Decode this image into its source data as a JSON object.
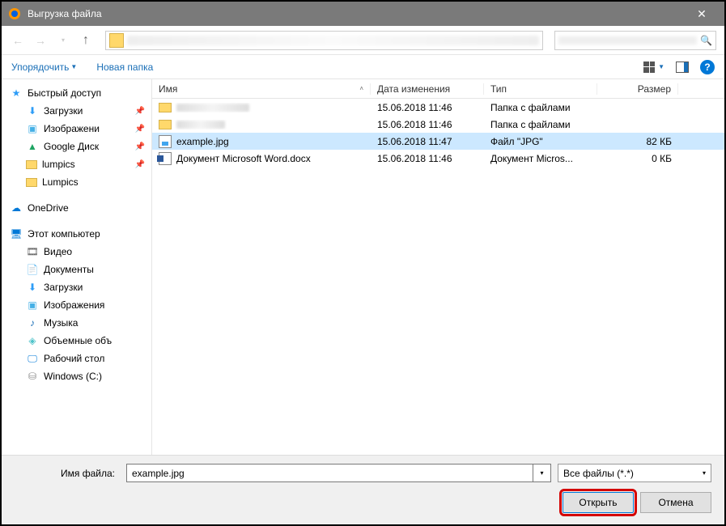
{
  "title": "Выгрузка файла",
  "toolbar": {
    "organize": "Упорядочить",
    "newfolder": "Новая папка"
  },
  "columns": {
    "name": "Имя",
    "date": "Дата изменения",
    "type": "Тип",
    "size": "Размер"
  },
  "sidebar": {
    "quick": "Быстрый доступ",
    "downloads": "Загрузки",
    "pictures": "Изображени",
    "gdrive": "Google Диск",
    "lumpics1": "lumpics",
    "lumpics2": "Lumpics",
    "onedrive": "OneDrive",
    "thispc": "Этот компьютер",
    "video": "Видео",
    "documents": "Документы",
    "downloads2": "Загрузки",
    "pictures2": "Изображения",
    "music": "Музыка",
    "objects3d": "Объемные объ",
    "desktop": "Рабочий стол",
    "cdrive": "Windows (C:)"
  },
  "files": {
    "r0": {
      "name": "",
      "date": "15.06.2018 11:46",
      "type": "Папка с файлами",
      "size": ""
    },
    "r1": {
      "name": "",
      "date": "15.06.2018 11:46",
      "type": "Папка с файлами",
      "size": ""
    },
    "r2": {
      "name": "example.jpg",
      "date": "15.06.2018 11:47",
      "type": "Файл \"JPG\"",
      "size": "82 КБ"
    },
    "r3": {
      "name": "Документ Microsoft Word.docx",
      "date": "15.06.2018 11:46",
      "type": "Документ Micros...",
      "size": "0 КБ"
    }
  },
  "bottom": {
    "filename_label": "Имя файла:",
    "filename_value": "example.jpg",
    "filter": "Все файлы (*.*)",
    "open": "Открыть",
    "cancel": "Отмена"
  }
}
